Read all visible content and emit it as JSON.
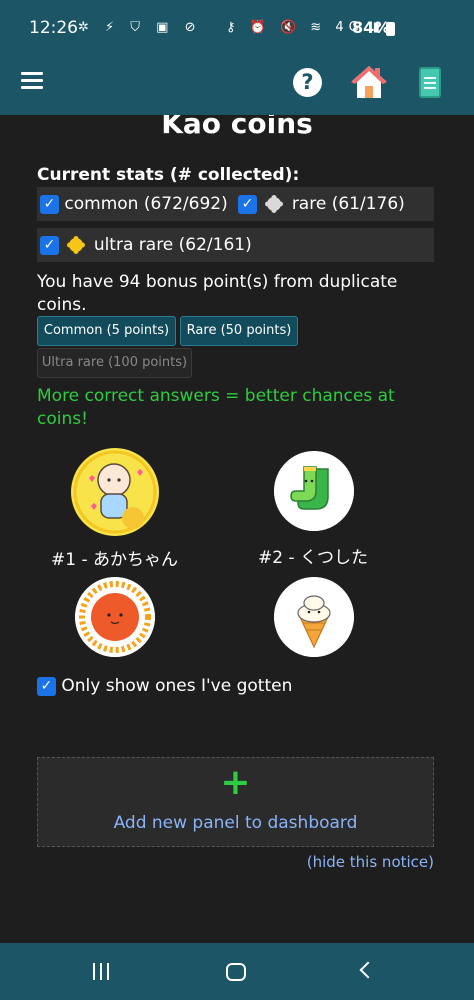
{
  "status": {
    "time": "12:26",
    "battery": "84%",
    "left_icons": "✲ ⚡ ⛉ ▣ ⊘",
    "right_icons": "⚷ ⏰ 🔇 ≋ 4G ▮"
  },
  "appbar": {
    "menu_icon": "hamburger-icon",
    "help_icon": "help-icon",
    "help_glyph": "?",
    "home_icon": "home-icon",
    "book_icon": "book-icon"
  },
  "page": {
    "title": "Kao coins",
    "stats_heading": "Current stats (# collected):",
    "check_glyph": "✓",
    "stats": [
      {
        "label": "common (672/692)",
        "checked": true,
        "coin_color": null
      },
      {
        "label": "rare (61/176)",
        "checked": true,
        "coin_color": "#d9d9d9"
      },
      {
        "label": "ultra rare (62/161)",
        "checked": true,
        "coin_color": "#f5c518"
      }
    ],
    "bonus_text": "You have 94 bonus point(s) from duplicate coins.",
    "buttons": [
      {
        "label": "Common (5 points)",
        "enabled": true
      },
      {
        "label": "Rare (50 points)",
        "enabled": true
      },
      {
        "label": "Ultra rare (100 points)",
        "enabled": false
      }
    ],
    "hint": "More correct answers = better chances at coins!",
    "coins": [
      {
        "label": "#1 - あかちゃん",
        "icon": "baby-coin-icon"
      },
      {
        "label": "#2 - くつした",
        "icon": "sock-coin-icon"
      },
      {
        "label": "",
        "icon": "sun-coin-icon"
      },
      {
        "label": "",
        "icon": "icecream-coin-icon"
      }
    ],
    "only_show_label": "Only show ones I've gotten",
    "add_panel": {
      "plus": "+",
      "label": "Add new panel to dashboard"
    },
    "hide_notice": "(hide this notice)"
  },
  "colors": {
    "bar": "#1c5566",
    "background": "#1e1e1e",
    "accent_green": "#2ecc40",
    "link_blue": "#8ab4f8",
    "checkbox_blue": "#1a73e8"
  }
}
